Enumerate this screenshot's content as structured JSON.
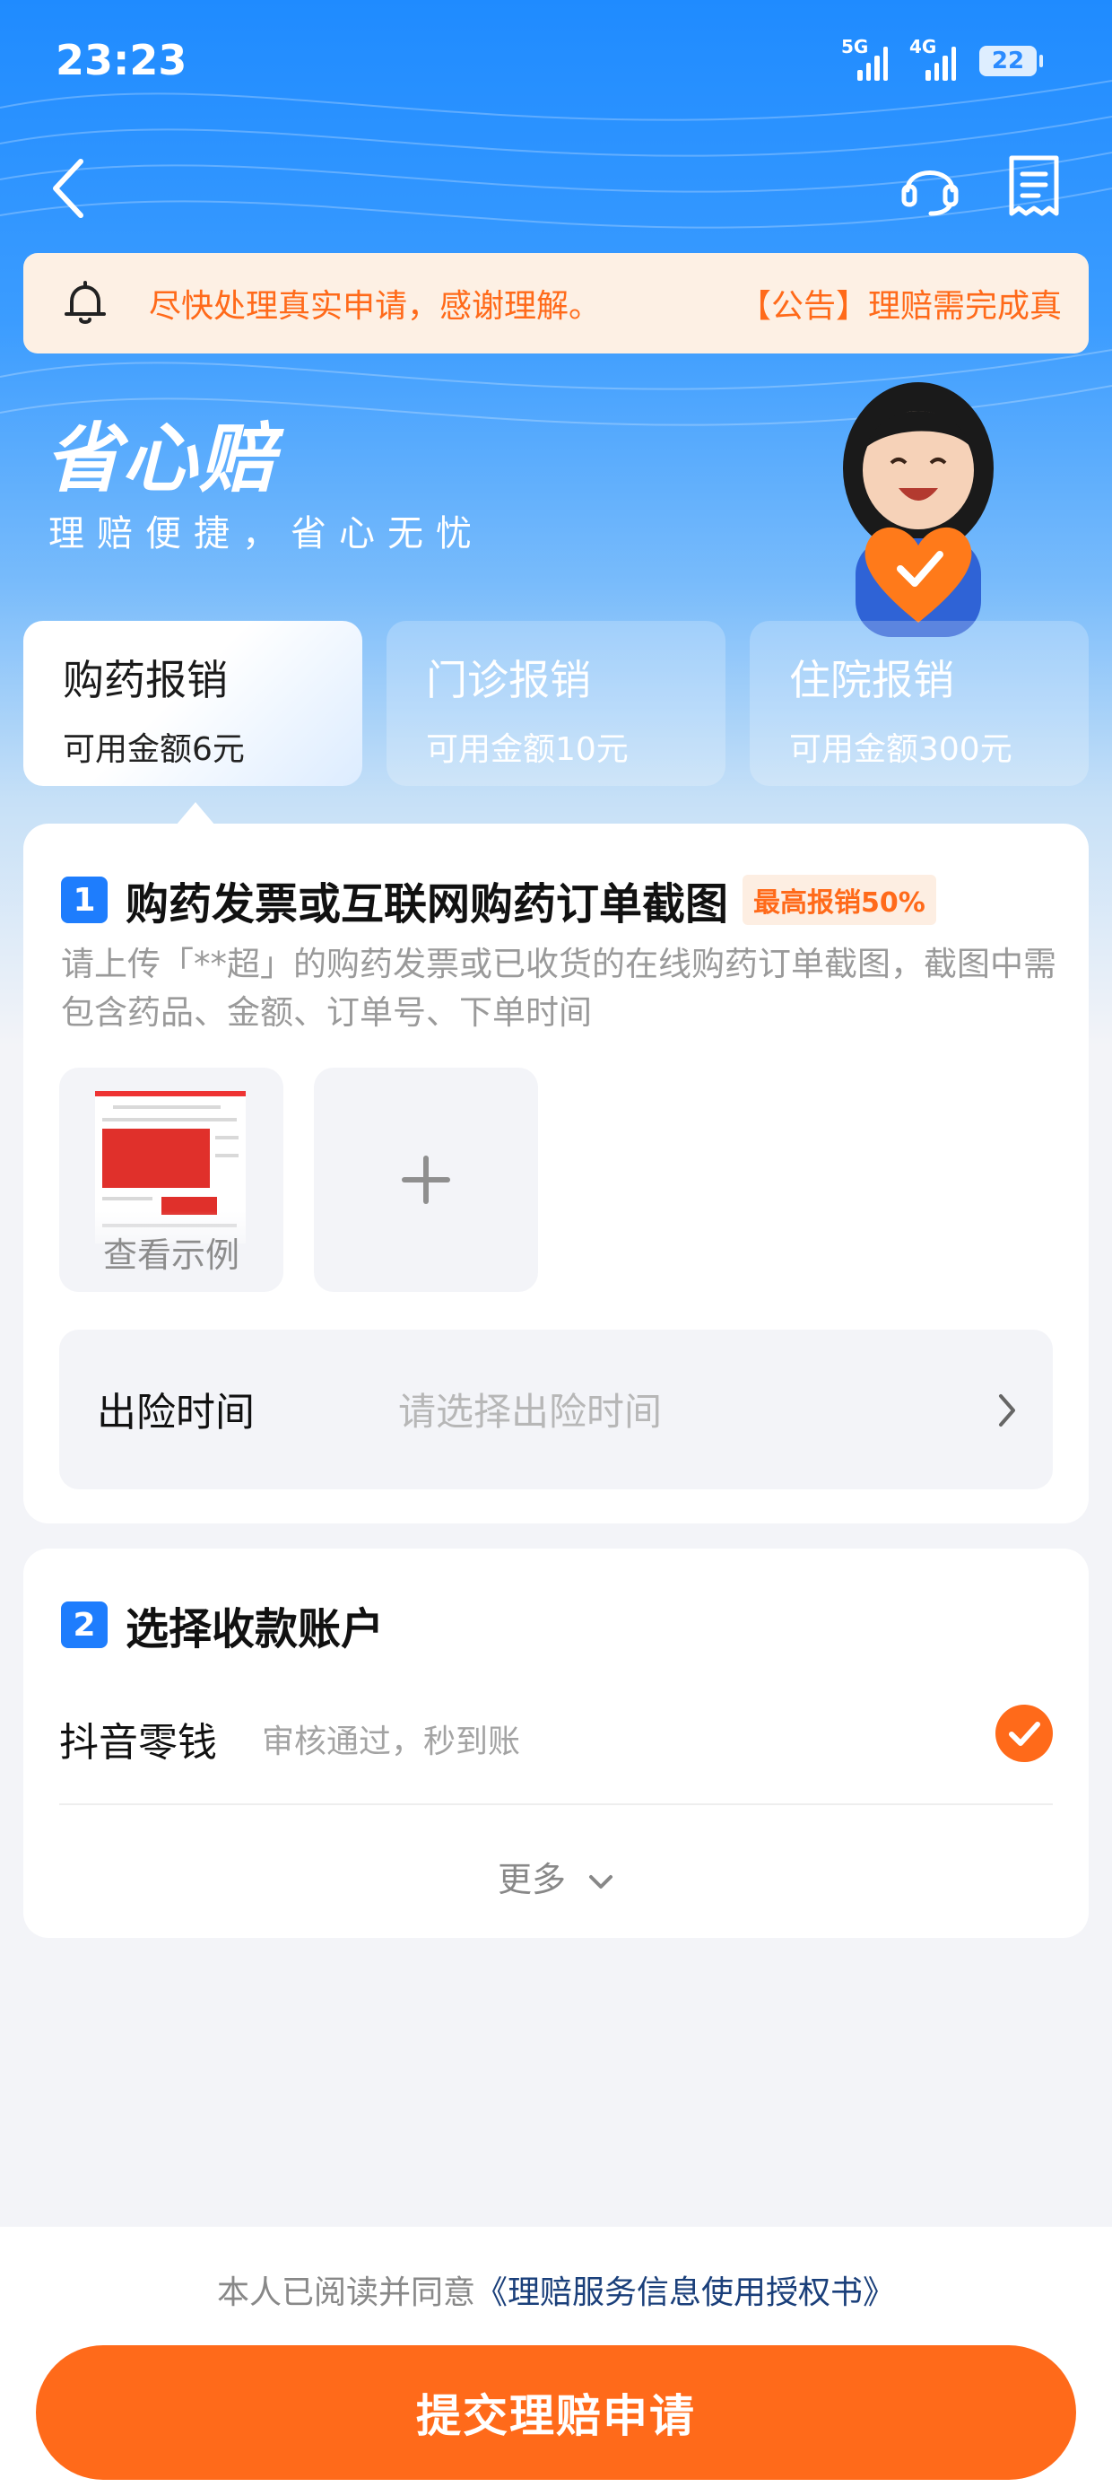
{
  "status_bar": {
    "time": "23:23",
    "signal1_label": "5G",
    "signal2_label": "4G",
    "battery": "22"
  },
  "notice": {
    "text_left": "尽快处理真实申请，感谢理解。",
    "text_right": "【公告】理赔需完成真"
  },
  "hero": {
    "title": "省心赔",
    "subtitle": "理赔便捷，省心无忧"
  },
  "tabs": [
    {
      "label": "购药报销",
      "amount": "可用金额6元"
    },
    {
      "label": "门诊报销",
      "amount": "可用金额10元"
    },
    {
      "label": "住院报销",
      "amount": "可用金额300元"
    }
  ],
  "section1": {
    "number": "1",
    "title": "购药发票或互联网购药订单截图",
    "tag": "最高报销50%",
    "description": "请上传「**超」的购药发票或已收货的在线购药订单截图，截图中需包含药品、金额、订单号、下单时间",
    "sample_label": "查看示例",
    "time_label": "出险时间",
    "time_placeholder": "请选择出险时间"
  },
  "section2": {
    "number": "2",
    "title": "选择收款账户",
    "account_name": "抖音零钱",
    "account_note": "审核通过，秒到账",
    "more_label": "更多"
  },
  "footer": {
    "agree_prefix": "本人已阅读并同意",
    "agree_link": "《理赔服务信息使用授权书》",
    "submit_label": "提交理赔申请"
  },
  "colors": {
    "primary_blue": "#1e7dfd",
    "accent_orange": "#ff6a1a",
    "notice_bg": "#fdf0e4"
  },
  "icons": [
    "back-arrow-icon",
    "customer-service-icon",
    "order-list-icon",
    "bell-icon",
    "plus-icon",
    "chevron-right-icon",
    "check-icon",
    "chevron-down-icon"
  ]
}
